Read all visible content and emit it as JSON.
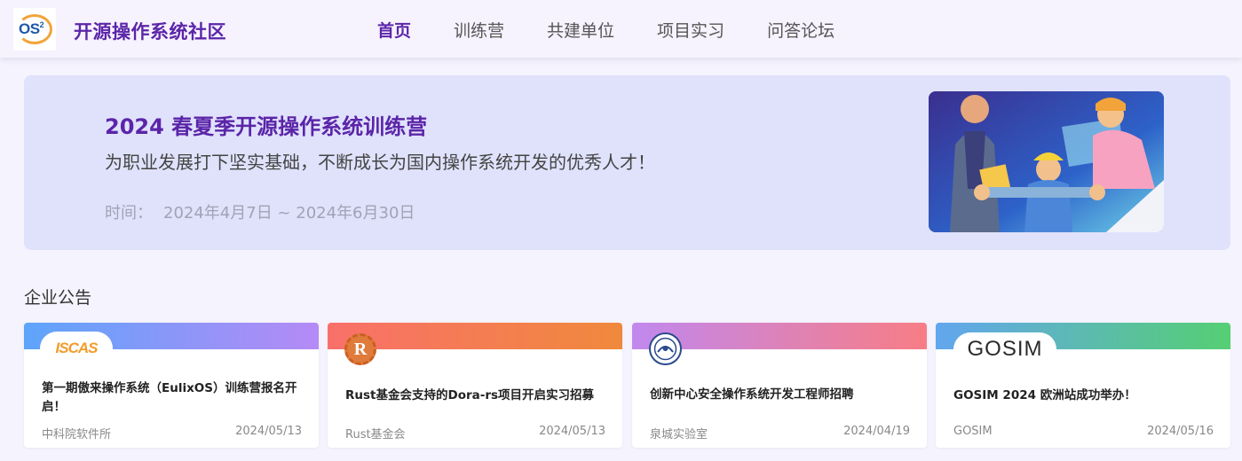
{
  "header": {
    "logo_text": "OS",
    "logo_sup": "2",
    "site_title": "开源操作系统社区",
    "nav": [
      {
        "label": "首页",
        "active": true
      },
      {
        "label": "训练营",
        "active": false
      },
      {
        "label": "共建单位",
        "active": false
      },
      {
        "label": "项目实习",
        "active": false
      },
      {
        "label": "问答论坛",
        "active": false
      }
    ]
  },
  "banner": {
    "title": "2024 春夏季开源操作系统训练营",
    "subtitle": "为职业发展打下坚实基础，不断成长为国内操作系统开发的优秀人才！",
    "date_label": "时间：",
    "date_range": "2024年4月7日 ~ 2024年6月30日"
  },
  "section": {
    "title": "企业公告"
  },
  "cards": [
    {
      "logo_text": "ISCAS",
      "title": "第一期傲来操作系统（EulixOS）训练营报名开启！",
      "source": "中科院软件所",
      "date": "2024/05/13",
      "strip_from": "#5ea4fb",
      "strip_to": "#b58af6"
    },
    {
      "logo_text": "R",
      "title": "Rust基金会支持的Dora-rs项目开启实习招募",
      "source": "Rust基金会",
      "date": "2024/05/13",
      "strip_from": "#f9706a",
      "strip_to": "#f0893c"
    },
    {
      "logo_text": "",
      "title": "创新中心安全操作系统开发工程师招聘",
      "source": "泉城实验室",
      "date": "2024/04/19",
      "strip_from": "#c188ee",
      "strip_to": "#f77d85"
    },
    {
      "logo_text": "GOSIM",
      "title": "GOSIM 2024 欧洲站成功举办！",
      "source": "GOSIM",
      "date": "2024/05/16",
      "strip_from": "#62a6ee",
      "strip_to": "#55cf73"
    }
  ]
}
